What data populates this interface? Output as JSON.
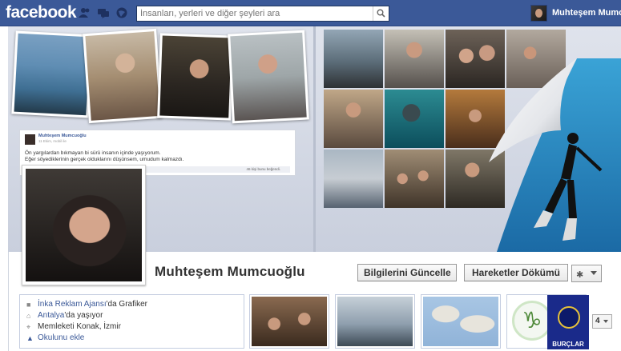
{
  "topbar": {
    "logo": "facebook",
    "icons": [
      "friend-requests-icon",
      "messages-icon",
      "notifications-icon"
    ],
    "search_placeholder": "İnsanları, yerleri ve diğer şeyleri ara",
    "user_name": "Muhteşem Mumcu"
  },
  "cover": {
    "post_name": "Muhteşem Mumcuoğlu",
    "post_meta": "11 Ekim, mobil ile",
    "post_line1": "Ön yargılardan bıkmayan bi sürü insanın içinde yaşıyorum.",
    "post_line2": "Eğer söyediklerinin gerçek olduklarını düşünsem, umudum kalmazdı.",
    "post_likes": "46 kişi bunu beğendi."
  },
  "profile": {
    "name": "Muhteşem Mumcuoğlu",
    "update_info_button": "Bilgilerini Güncelle",
    "activity_log_button": "Hareketler Dökümü",
    "info": [
      {
        "link": "İnka Reklam Ajansı",
        "rest": "'da Grafiker"
      },
      {
        "link": "Antalya",
        "rest": "'da yaşıyor"
      },
      {
        "link": "",
        "rest": "Memleketi Konak, İzmir"
      },
      {
        "link": "Okulunu ekle",
        "rest": ""
      }
    ],
    "apps_label": "BURÇLAR",
    "count": "4"
  },
  "colors": {
    "brand": "#3b5998",
    "cover_bg": "#dfe3ec"
  }
}
